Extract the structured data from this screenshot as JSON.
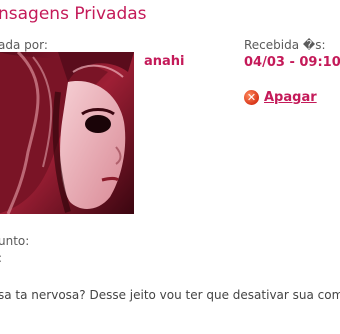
{
  "page": {
    "title": "nsagens Privadas"
  },
  "message": {
    "sender_label": "ada por:",
    "sender_name": "anahi",
    "received_label": "Recebida �s:",
    "received_value": "04/03 - 09:10",
    "delete_label": "Apagar",
    "subject_label": "unto:",
    "subject_value": ":",
    "body": "sa ta nervosa? Desse jeito vou ter que desativar sua com"
  },
  "icons": {
    "delete": "delete-icon"
  },
  "colors": {
    "accent": "#c41a59",
    "label": "#5a5a5a",
    "delete_icon": "#d8361a"
  }
}
